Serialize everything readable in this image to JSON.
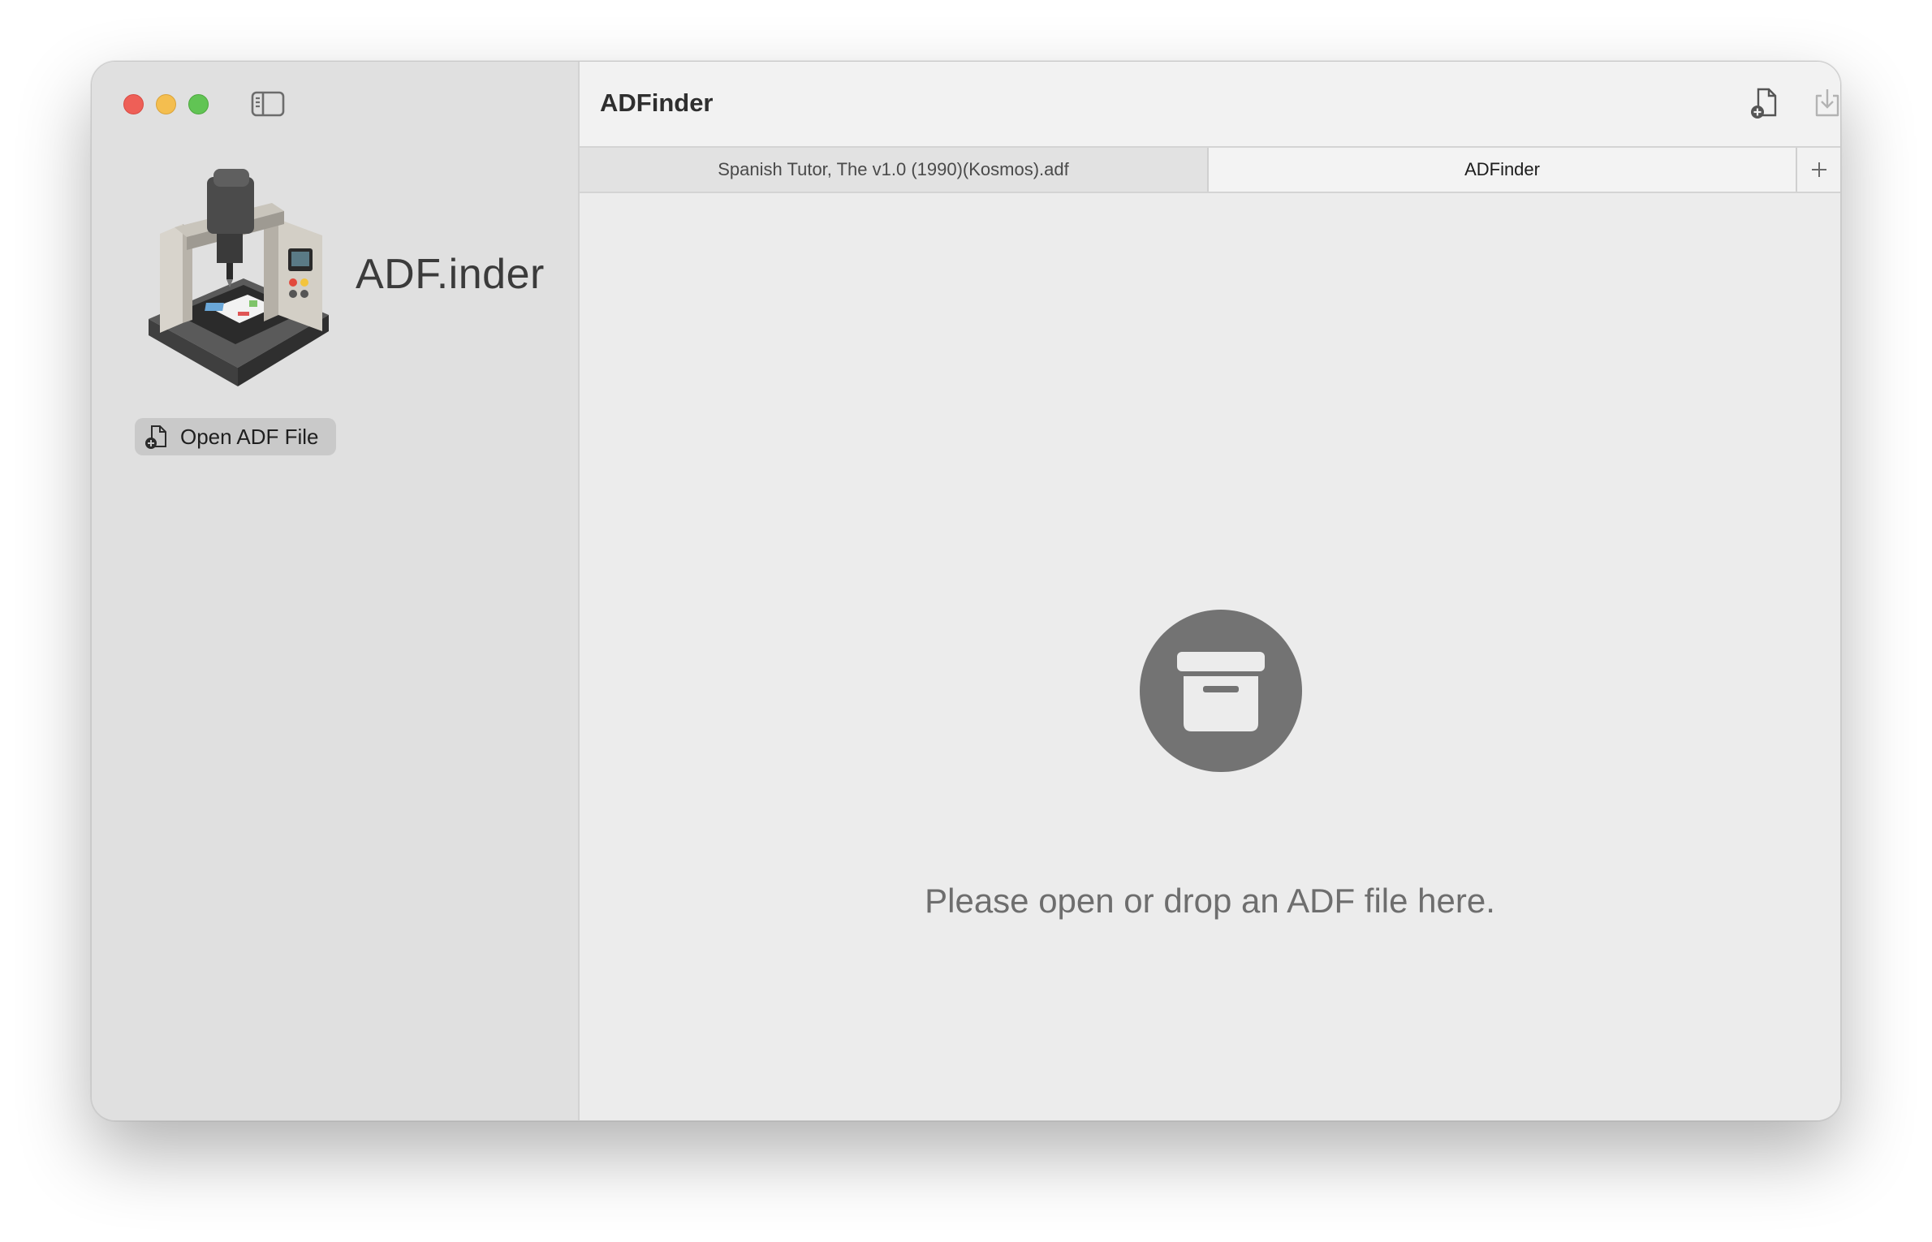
{
  "sidebar": {
    "app_name": "ADF.inder",
    "open_button_label": "Open ADF File"
  },
  "toolbar": {
    "title": "ADFinder",
    "icons": [
      "new-document-icon",
      "download-icon",
      "info-icon"
    ]
  },
  "tabs": [
    {
      "label": "Spanish Tutor, The v1.0 (1990)(Kosmos).adf",
      "active": false
    },
    {
      "label": "ADFinder",
      "active": true
    }
  ],
  "empty_state": {
    "icon": "archive-box-icon",
    "message": "Please open or drop an ADF file here."
  },
  "colors": {
    "close": "#ee5f57",
    "minimize": "#f4be4f",
    "maximize": "#61c454",
    "sidebar_bg": "#e0e0e0",
    "content_bg": "#ececec"
  }
}
